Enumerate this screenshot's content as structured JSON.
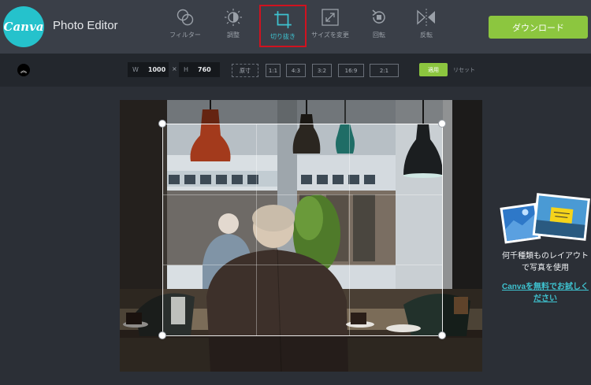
{
  "app": {
    "logo_text": "Canva",
    "title": "Photo Editor",
    "download_label": "ダウンロード"
  },
  "tools": [
    {
      "label": "フィルター",
      "icon": "filter-icon",
      "active": false
    },
    {
      "label": "調整",
      "icon": "adjust-icon",
      "active": false
    },
    {
      "label": "切り抜き",
      "icon": "crop-icon",
      "active": true
    },
    {
      "label": "サイズを変更",
      "icon": "resize-icon",
      "active": false
    },
    {
      "label": "回転",
      "icon": "rotate-icon",
      "active": false
    },
    {
      "label": "反転",
      "icon": "flip-icon",
      "active": false
    }
  ],
  "crop_toolbar": {
    "width_label": "W",
    "width_value": "1000",
    "times": "×",
    "height_label": "H",
    "height_value": "760",
    "ratios": [
      "原寸",
      "1:1",
      "4:3",
      "3:2",
      "16:9",
      "2:1"
    ],
    "apply_label": "適用",
    "reset_label": "リセット"
  },
  "promo": {
    "text": "何千種類ものレイアウトで写真を使用",
    "link": "Canvaを無料でお試しください"
  },
  "colors": {
    "accent_teal": "#25c2cc",
    "accent_green": "#8cc63f",
    "highlight_red": "#d0121f"
  }
}
